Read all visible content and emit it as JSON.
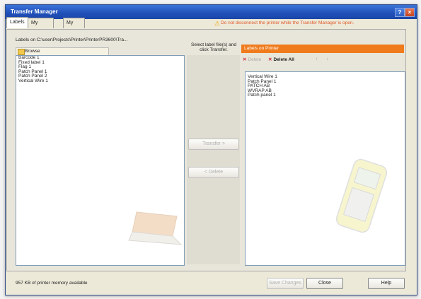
{
  "window": {
    "title": "Transfer Manager"
  },
  "titlebar_buttons": {
    "help": "?",
    "close": "×"
  },
  "tabs": [
    {
      "label": "Labels",
      "active": true
    },
    {
      "label": "My Symbols",
      "active": false
    },
    {
      "label": "My Library",
      "active": false
    }
  ],
  "warning": {
    "icon": "warning-icon",
    "text": "Do not disconnect the printer while the Transfer Manager is open."
  },
  "left": {
    "path_label": "Labels on C:\\user\\Projects\\Printer\\PrinterPR3600\\Tra...",
    "browse_label": "Browse",
    "items": [
      "Barcode 1",
      "Fixed label 1",
      "Flag 1",
      "Patch Panel 1",
      "Patch Panel 2",
      "Vertical Wire 1"
    ]
  },
  "middle": {
    "instruction": "Select label file(s) and click Transfer.",
    "transfer_button": "Transfer >",
    "delete_button": "< Delete"
  },
  "right": {
    "header": "Labels on Printer",
    "delete_label": "Delete",
    "delete_all_label": "Delete All",
    "up_label": "↑",
    "down_label": "↓",
    "items": [
      "Vertical Wire 1",
      "Patch Panel 1",
      "PATCH AB",
      "WVRAP AB",
      "Patch panel 1"
    ]
  },
  "status": {
    "text": "957 KB of printer memory available"
  },
  "buttons": {
    "save": "Save Changes",
    "close": "Close",
    "help": "Help"
  },
  "colors": {
    "title_bar": "#1f4fb8",
    "accent_orange": "#f07b1c",
    "warning_text": "#e05a2a"
  }
}
